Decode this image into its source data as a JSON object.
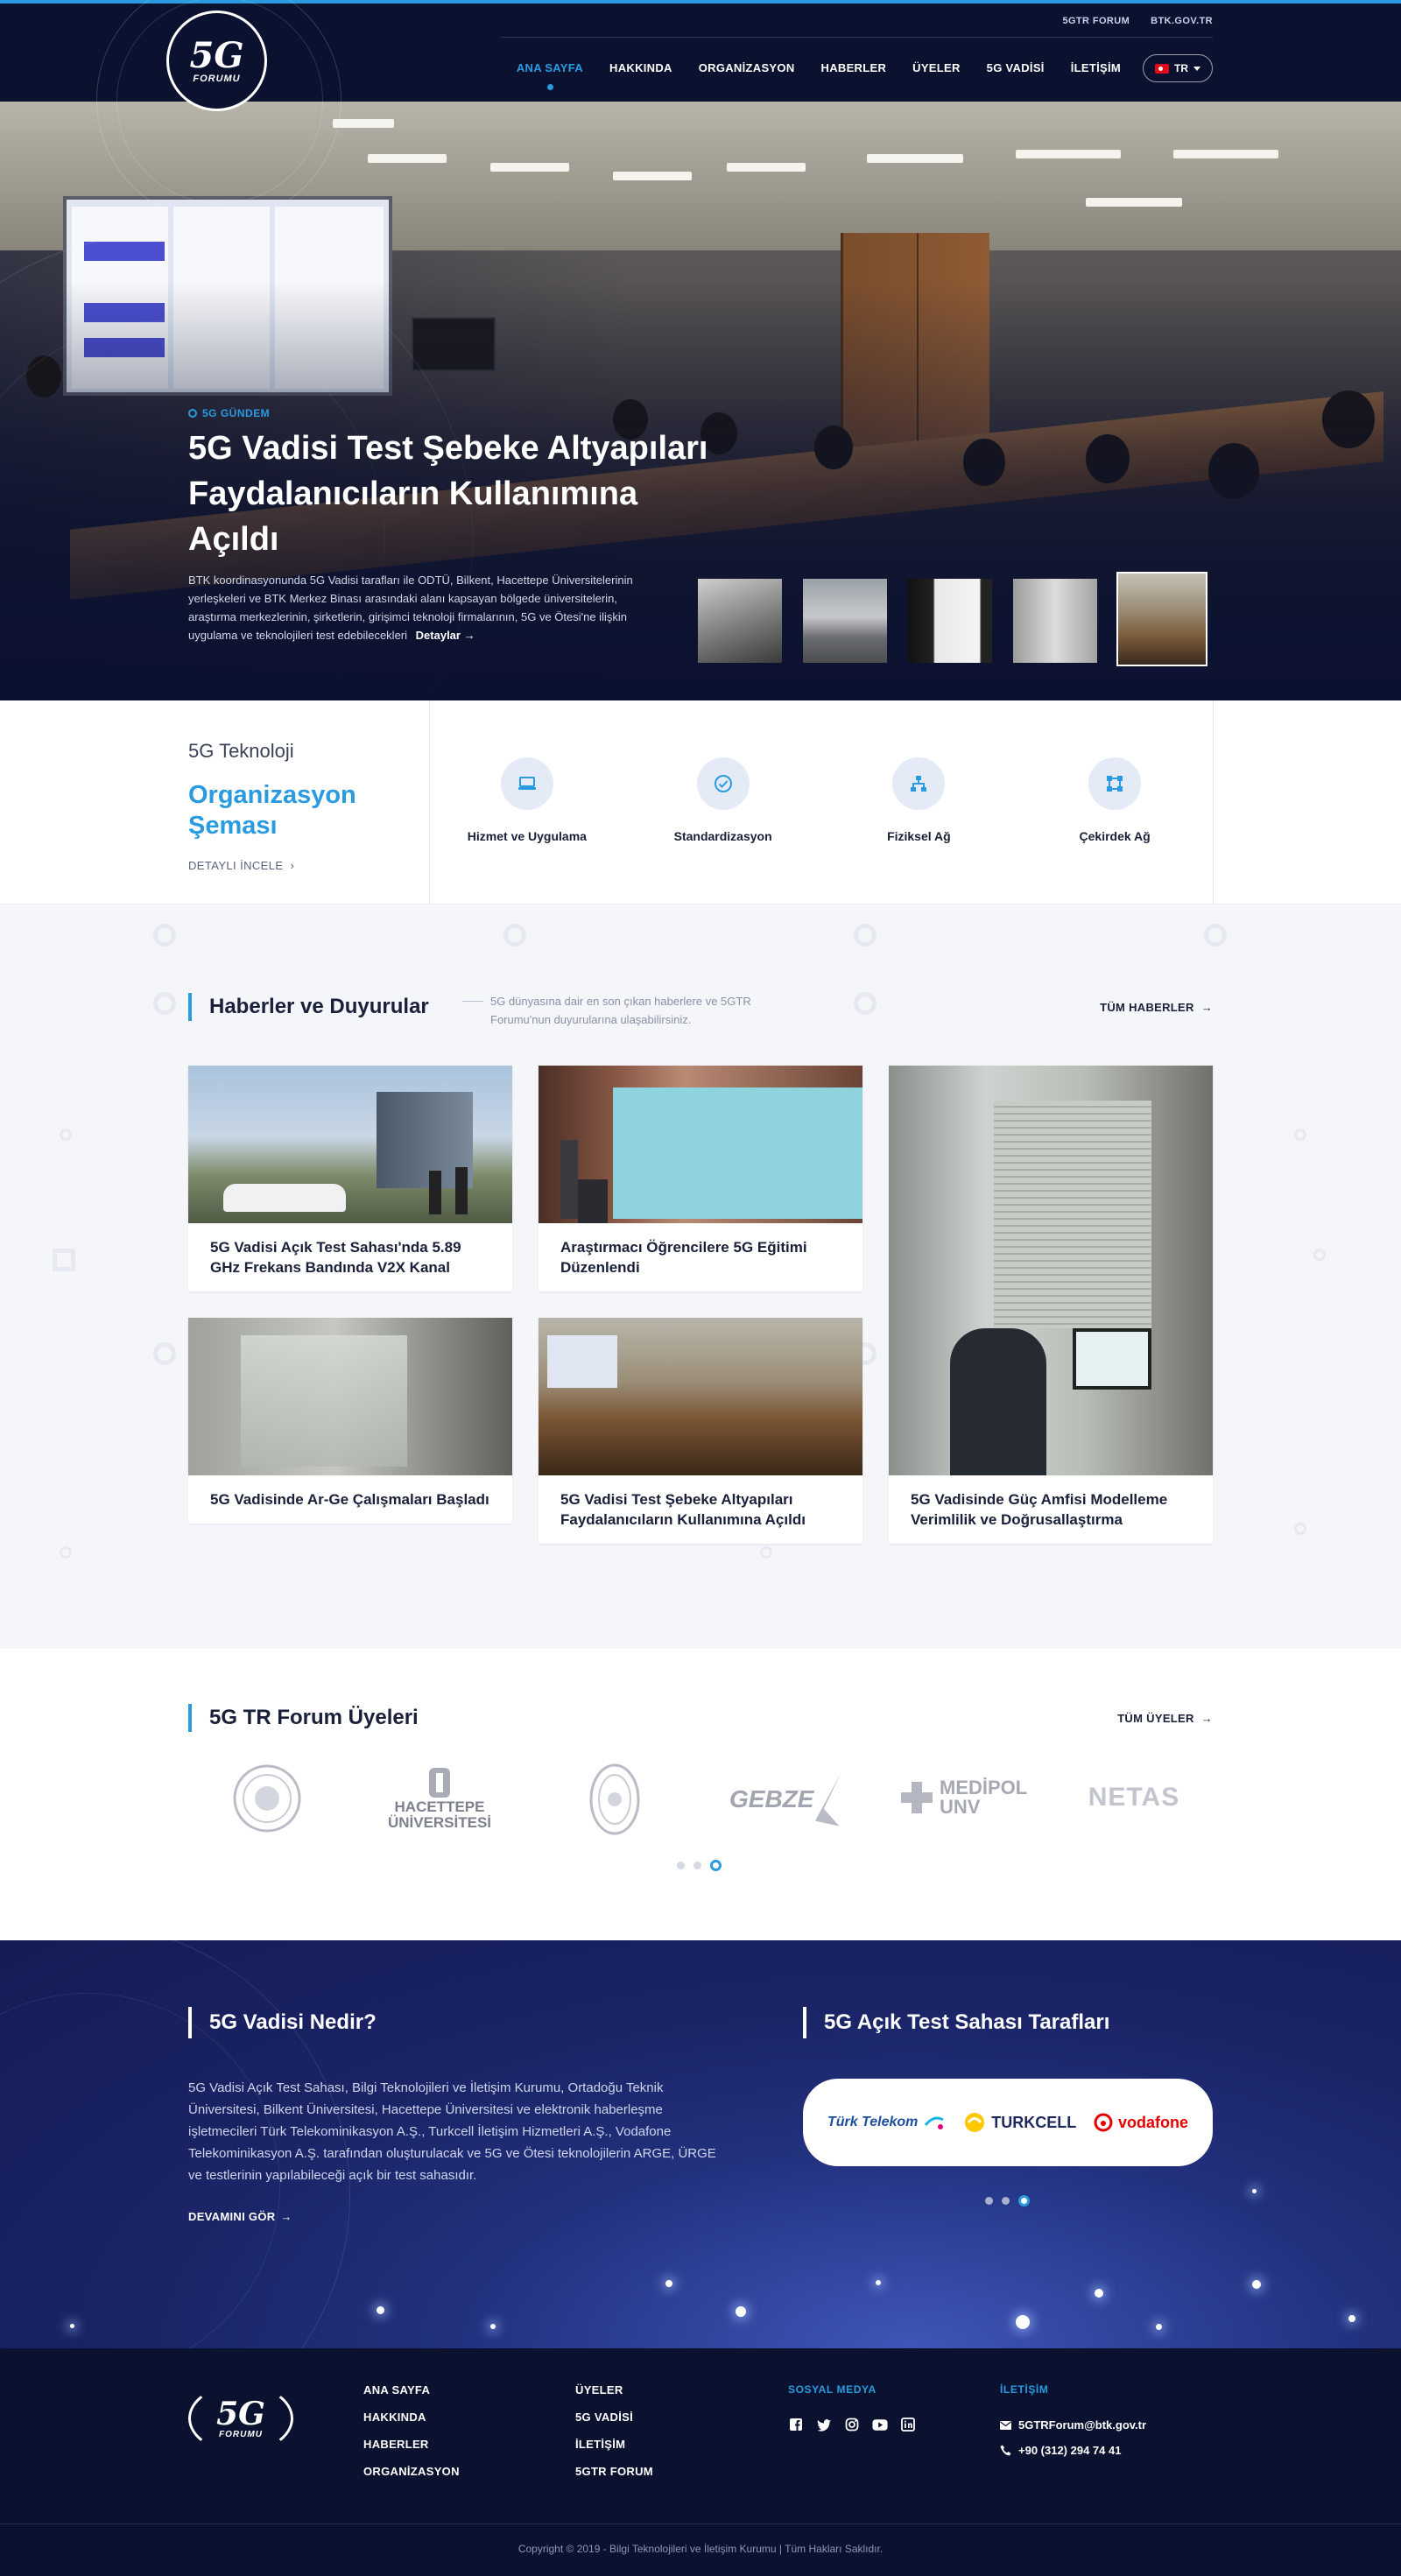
{
  "header": {
    "logo": {
      "big": "5G",
      "small": "FORUMU"
    },
    "top_links": [
      "5GTR FORUM",
      "BTK.GOV.TR"
    ],
    "nav": [
      "ANA SAYFA",
      "HAKKINDA",
      "ORGANİZASYON",
      "HABERLER",
      "ÜYELER",
      "5G VADİSİ",
      "İLETİŞİM"
    ],
    "active_nav": "ANA SAYFA",
    "lang": "TR"
  },
  "hero": {
    "tag": "5G GÜNDEM",
    "title": "5G Vadisi Test Şebeke Altyapıları Faydalanıcıların Kullanımına Açıldı",
    "description": "BTK koordinasyonunda 5G Vadisi tarafları ile ODTÜ, Bilkent, Hacettepe Üniversitelerinin yerleşkeleri ve BTK Merkez Binası arasındaki alanı kapsayan bölgede üniversitelerin, araştırma merkezlerinin, şirketlerin, girişimci teknoloji firmalarının, 5G ve Ötesi'ne ilişkin uygulama ve teknolojileri test edebilecekleri",
    "more": "Detaylar"
  },
  "org": {
    "subtitle": "5G Teknoloji",
    "title": "Organizasyon Şeması",
    "link": "DETAYLI İNCELE",
    "items": [
      {
        "label": "Hizmet ve Uygulama",
        "icon": "laptop-icon"
      },
      {
        "label": "Standardizasyon",
        "icon": "check-circle-icon"
      },
      {
        "label": "Fiziksel Ağ",
        "icon": "network-icon"
      },
      {
        "label": "Çekirdek Ağ",
        "icon": "core-network-icon"
      }
    ]
  },
  "news": {
    "title": "Haberler ve Duyurular",
    "note": "5G dünyasına dair en son çıkan haberlere ve 5GTR Forumu'nun duyurularına ulaşabilirsiniz.",
    "all": "TÜM HABERLER",
    "cards": [
      {
        "title": "5G Vadisi Açık Test Sahası'nda 5.89 GHz Frekans Bandında V2X Kanal"
      },
      {
        "title": "Araştırmacı Öğrencilere 5G Eğitimi Düzenlendi"
      },
      {
        "title": "5G Vadisinde Güç Amfisi Modelleme Verimlilik ve Doğrusallaştırma"
      },
      {
        "title": "5G Vadisinde Ar-Ge Çalışmaları Başladı"
      },
      {
        "title": "5G Vadisi Test Şebeke Altyapıları Faydalanıcıların Kullanımına Açıldı"
      }
    ]
  },
  "members": {
    "title": "5G TR Forum Üyeleri",
    "all": "TÜM ÜYELER",
    "logos": [
      {
        "name": ""
      },
      {
        "name": "HACETTEPE ÜNİVERSİTESİ"
      },
      {
        "name": ""
      },
      {
        "name": "GEBZE"
      },
      {
        "name": "MEDİPOL UNV"
      },
      {
        "name": "NETAS"
      }
    ]
  },
  "valley": {
    "title": "5G Vadisi Nedir?",
    "text": "5G Vadisi Açık Test Sahası, Bilgi Teknolojileri ve İletişim Kurumu, Ortadoğu Teknik Üniversitesi, Bilkent Üniversitesi, Hacettepe Üniversitesi ve elektronik haberleşme işletmecileri Türk Telekominikasyon A.Ş., Turkcell İletişim Hizmetleri A.Ş., Vodafone Telekominikasyon A.Ş. tarafından oluşturulacak ve 5G ve Ötesi teknolojilerin ARGE, ÜRGE ve testlerinin yapılabileceği açık bir test sahasıdır.",
    "more": "DEVAMINI GÖR",
    "partners_title": "5G Açık Test Sahası Tarafları",
    "partners": [
      "Türk Telekom",
      "TURKCELL",
      "vodafone"
    ]
  },
  "footer": {
    "col1": [
      "ANA SAYFA",
      "HAKKINDA",
      "HABERLER",
      "ORGANİZASYON"
    ],
    "col2": [
      "ÜYELER",
      "5G VADİSİ",
      "İLETİŞİM",
      "5GTR FORUM"
    ],
    "social_title": "SOSYAL MEDYA",
    "contact_title": "İLETİŞİM",
    "email": "5GTRForum@btk.gov.tr",
    "phone": "+90 (312) 294 74 41",
    "copyright": "Copyright © 2019 - Bilgi Teknolojileri ve İletişim Kurumu | Tüm Hakları Saklıdır."
  },
  "colors": {
    "navy": "#0b1230",
    "accent": "#2a9be0",
    "valley": "#1a2466"
  }
}
